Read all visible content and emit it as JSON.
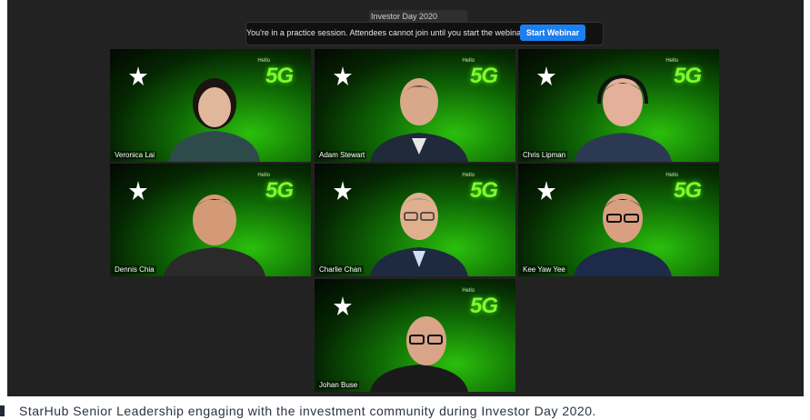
{
  "meeting": {
    "title": "Investor Day 2020",
    "banner_text": "You're in a practice session. Attendees cannot join until you start the webinar.",
    "start_button": "Start Webinar"
  },
  "tiles": [
    {
      "name": "Veronica Lai"
    },
    {
      "name": "Adam Stewart"
    },
    {
      "name": "Chris Lipman"
    },
    {
      "name": "Dennis Chia"
    },
    {
      "name": "Charlie Chan"
    },
    {
      "name": "Kee Yaw Yee"
    },
    {
      "name": "Johan Buse"
    }
  ],
  "caption": "StarHub Senior Leadership engaging with the investment community during Investor Day 2020.",
  "colors": {
    "accent_green": "#7dfa2c",
    "button_blue": "#1b7ff0",
    "background": "#222222"
  }
}
